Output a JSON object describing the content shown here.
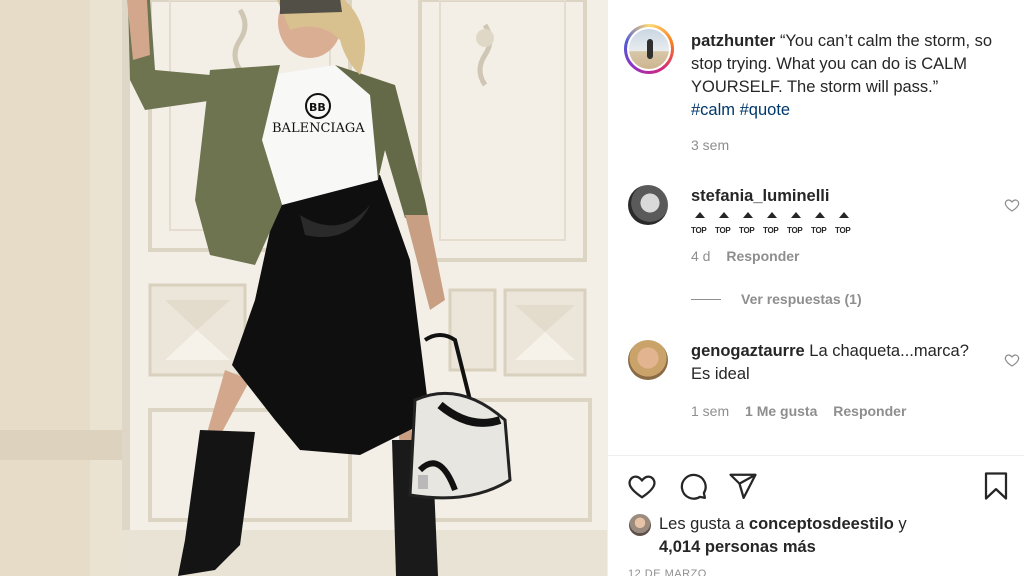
{
  "post": {
    "author": "patzhunter",
    "caption": "“You can’t calm the storm, so stop trying. What you can do is CALM YOURSELF. The storm will pass.”",
    "hashtags": [
      "#calm",
      "#quote"
    ],
    "time": "3 sem"
  },
  "comments": [
    {
      "username": "stefania_luminelli",
      "text": "",
      "emoji_label": "TOP",
      "emoji_count": 7,
      "time": "4 d",
      "likes": "",
      "reply_label": "Responder"
    },
    {
      "username": "genogaztaurre",
      "text": "La chaqueta...marca? Es ideal",
      "time": "1 sem",
      "likes": "1 Me gusta",
      "reply_label": "Responder"
    }
  ],
  "view_replies": "Ver respuestas (1)",
  "likes": {
    "prefix": "Les gusta a",
    "first_user": "conceptosdeestilo",
    "connector": "y",
    "others": "4,014 personas más"
  },
  "date": "12 DE MARZO",
  "icons": {
    "like": "heart-icon",
    "comment": "comment-icon",
    "share": "paper-plane-icon",
    "save": "bookmark-icon"
  },
  "colors": {
    "text": "#262626",
    "secondary": "#8e8e8e",
    "hashtag": "#00376b",
    "border": "#efefef"
  }
}
